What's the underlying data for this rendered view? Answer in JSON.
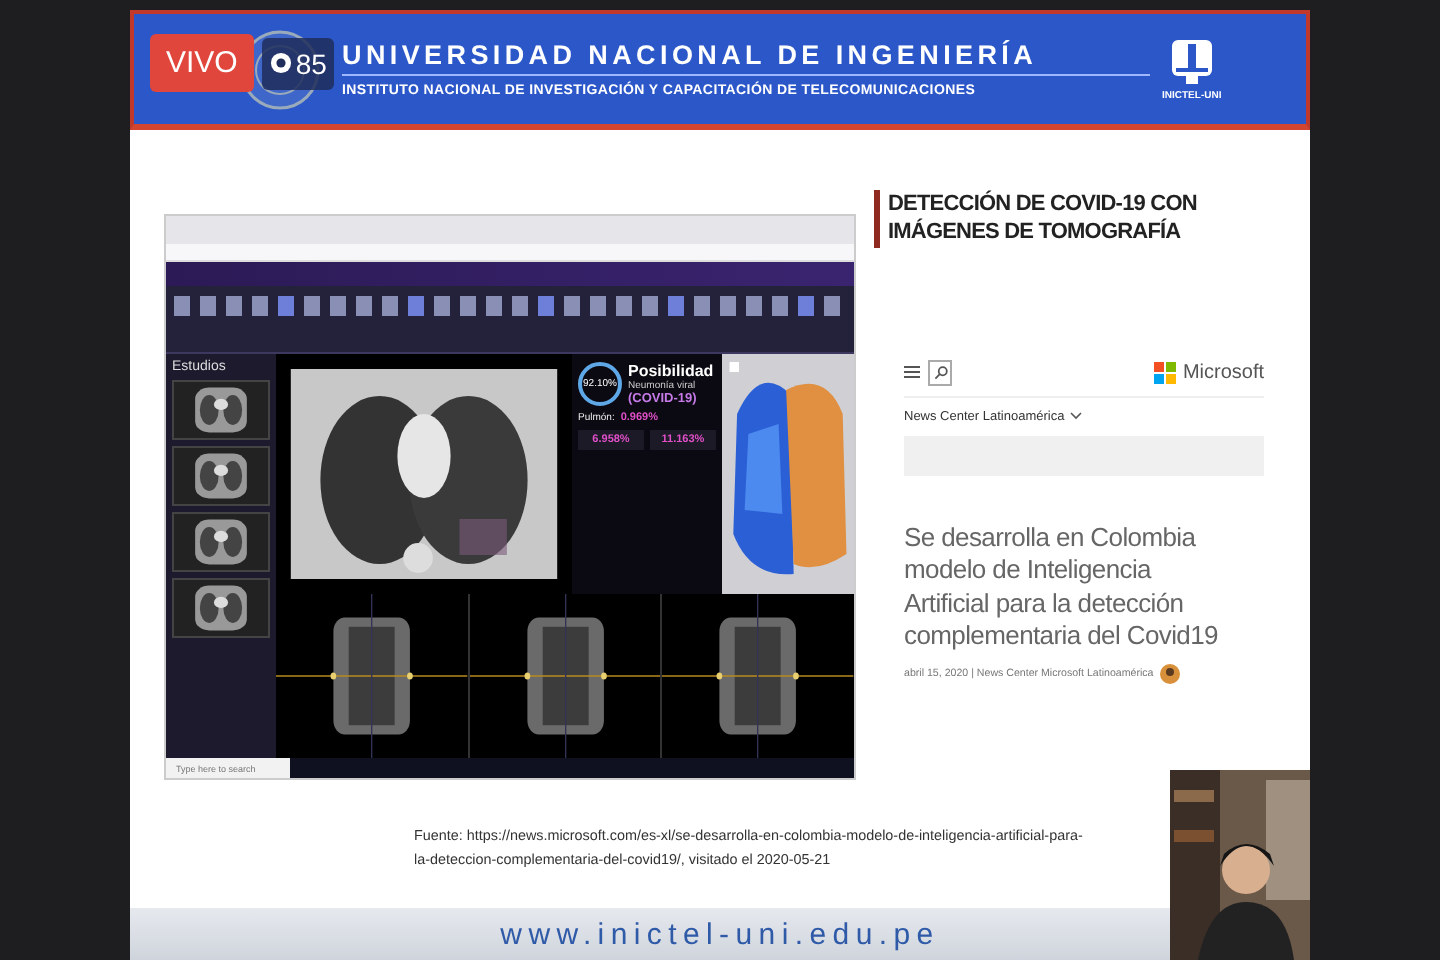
{
  "stream": {
    "live_label": "VIVO",
    "viewers": "85"
  },
  "header": {
    "title": "UNIVERSIDAD NACIONAL DE INGENIERÍA",
    "subtitle": "INSTITUTO NACIONAL DE INVESTIGACIÓN Y CAPACITACIÓN DE TELECOMUNICACIONES",
    "logo_caption": "INICTEL-UNI"
  },
  "slide": {
    "title": "DETECCIÓN DE COVID-19 CON IMÁGENES DE TOMOGRAFÍA",
    "app_screenshot": {
      "sidebar_title": "Estudios",
      "probability": "92.10%",
      "headline": "Posibilidad",
      "subtitle": "Neumonía viral",
      "label": "(COVID-19)",
      "lung_label": "Pulmón:",
      "lung_value": "0.969%",
      "left_value": "6.958%",
      "right_value": "11.163%",
      "taskbar_search": "Type here to search"
    },
    "article": {
      "brand": "Microsoft",
      "section": "News Center Latinoamérica",
      "headline": "Se desarrolla en Colombia modelo de Inteligencia Artificial para la detección complementaria del Covid19",
      "byline": "abril 15, 2020 | News Center Microsoft Latinoamérica"
    },
    "source": "Fuente: https://news.microsoft.com/es-xl/se-desarrolla-en-colombia-modelo-de-inteligencia-artificial-para-la-deteccion-complementaria-del-covid19/, visitado el 2020-05-21"
  },
  "footer": {
    "url": "www.inictel-uni.edu.pe"
  }
}
